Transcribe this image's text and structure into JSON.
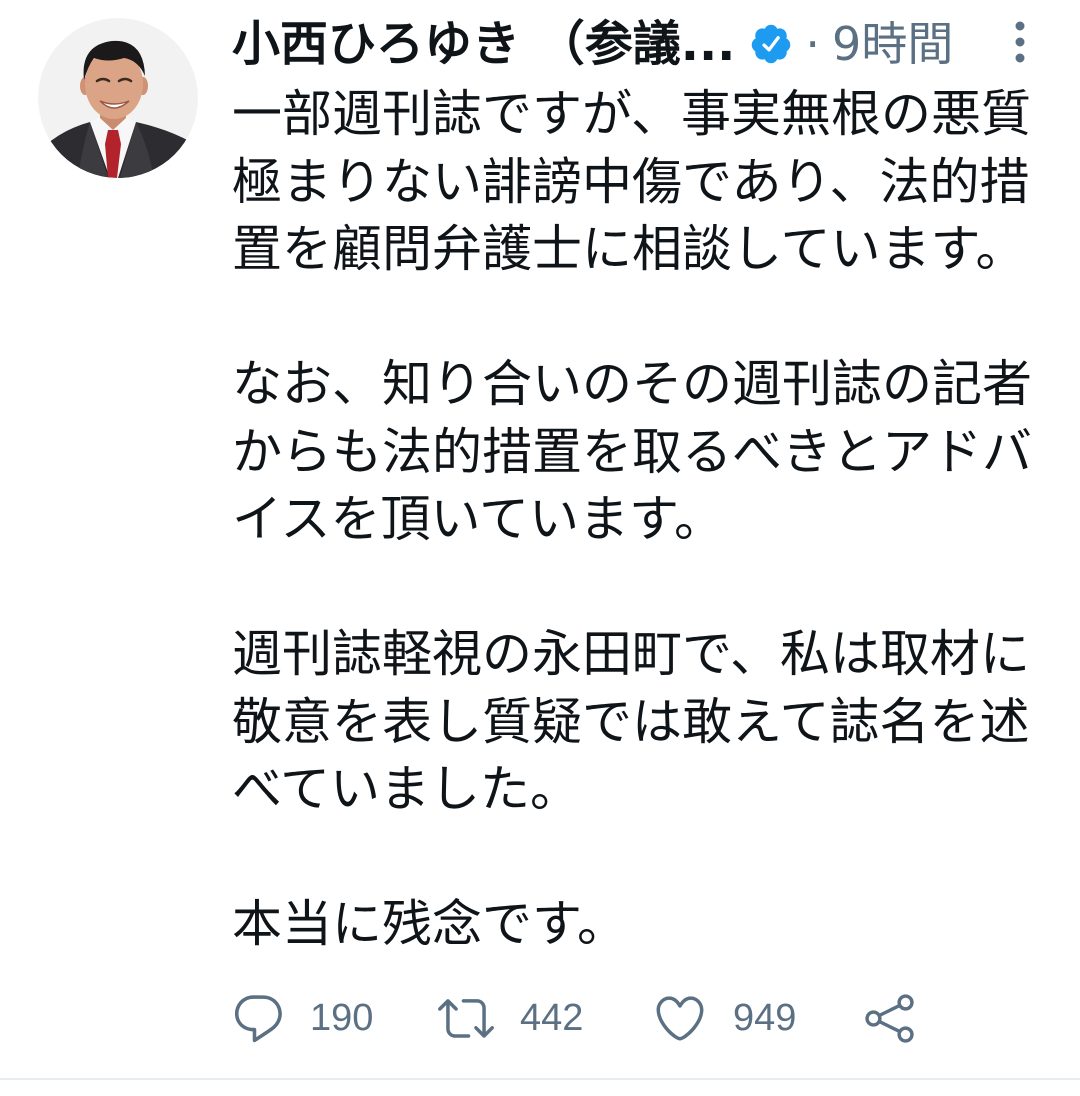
{
  "tweet": {
    "author": {
      "display_name": "小西ひろゆき （参議...",
      "verified": true,
      "avatar_icon": "avatar-photo",
      "verified_icon": "verified-badge-icon"
    },
    "time_separator": "·",
    "timestamp": "9時間",
    "more_icon": "more-vertical-icon",
    "paragraphs": [
      [
        "一部週刊誌ですが、事実無根の悪質",
        "極まりない誹謗中傷であり、法的措",
        "置を顧問弁護士に相談しています。"
      ],
      [
        "なお、知り合いのその週刊誌の記者",
        "からも法的措置を取るべきとアドバ",
        "イスを頂いています。"
      ],
      [
        "週刊誌軽視の永田町で、私は取材に",
        "敬意を表し質疑では敢えて誌名を述",
        "べていました。"
      ],
      [
        "本当に残念です。"
      ]
    ],
    "actions": {
      "reply": {
        "icon": "reply-icon",
        "count": "190"
      },
      "retweet": {
        "icon": "retweet-icon",
        "count": "442"
      },
      "like": {
        "icon": "heart-icon",
        "count": "949"
      },
      "share": {
        "icon": "share-icon"
      }
    }
  },
  "colors": {
    "text": "#0f1419",
    "secondary": "#5b7083",
    "verified": "#1d9bf0",
    "divider": "#e6ecf0",
    "background": "#ffffff"
  }
}
